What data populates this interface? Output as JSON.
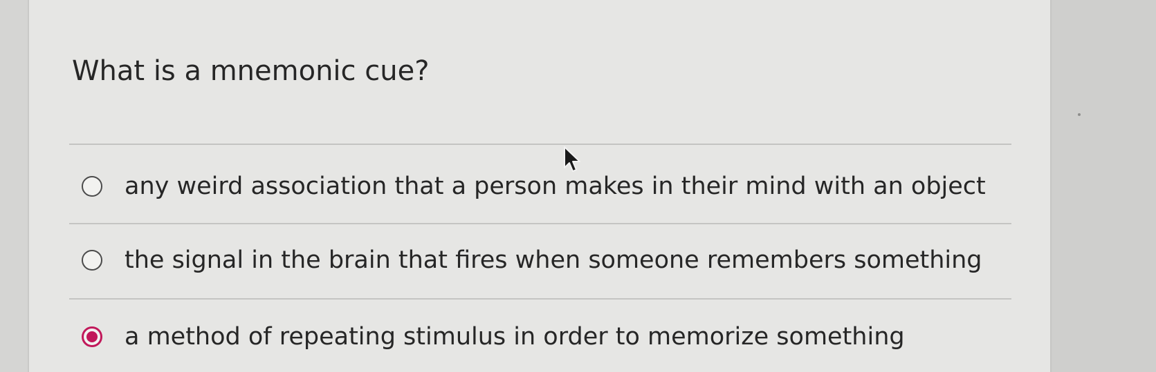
{
  "question": {
    "text": "What is a mnemonic cue?"
  },
  "options": [
    {
      "label": "any weird association that a person makes in their mind with an object",
      "selected": false
    },
    {
      "label": "the signal in the brain that fires when someone remembers something",
      "selected": false
    },
    {
      "label": "a method of repeating stimulus in order to memorize something",
      "selected": true
    }
  ],
  "colors": {
    "selected_radio": "#c1185a",
    "text": "#262626"
  },
  "icons": {
    "pointer": "mouse-pointer-icon"
  }
}
